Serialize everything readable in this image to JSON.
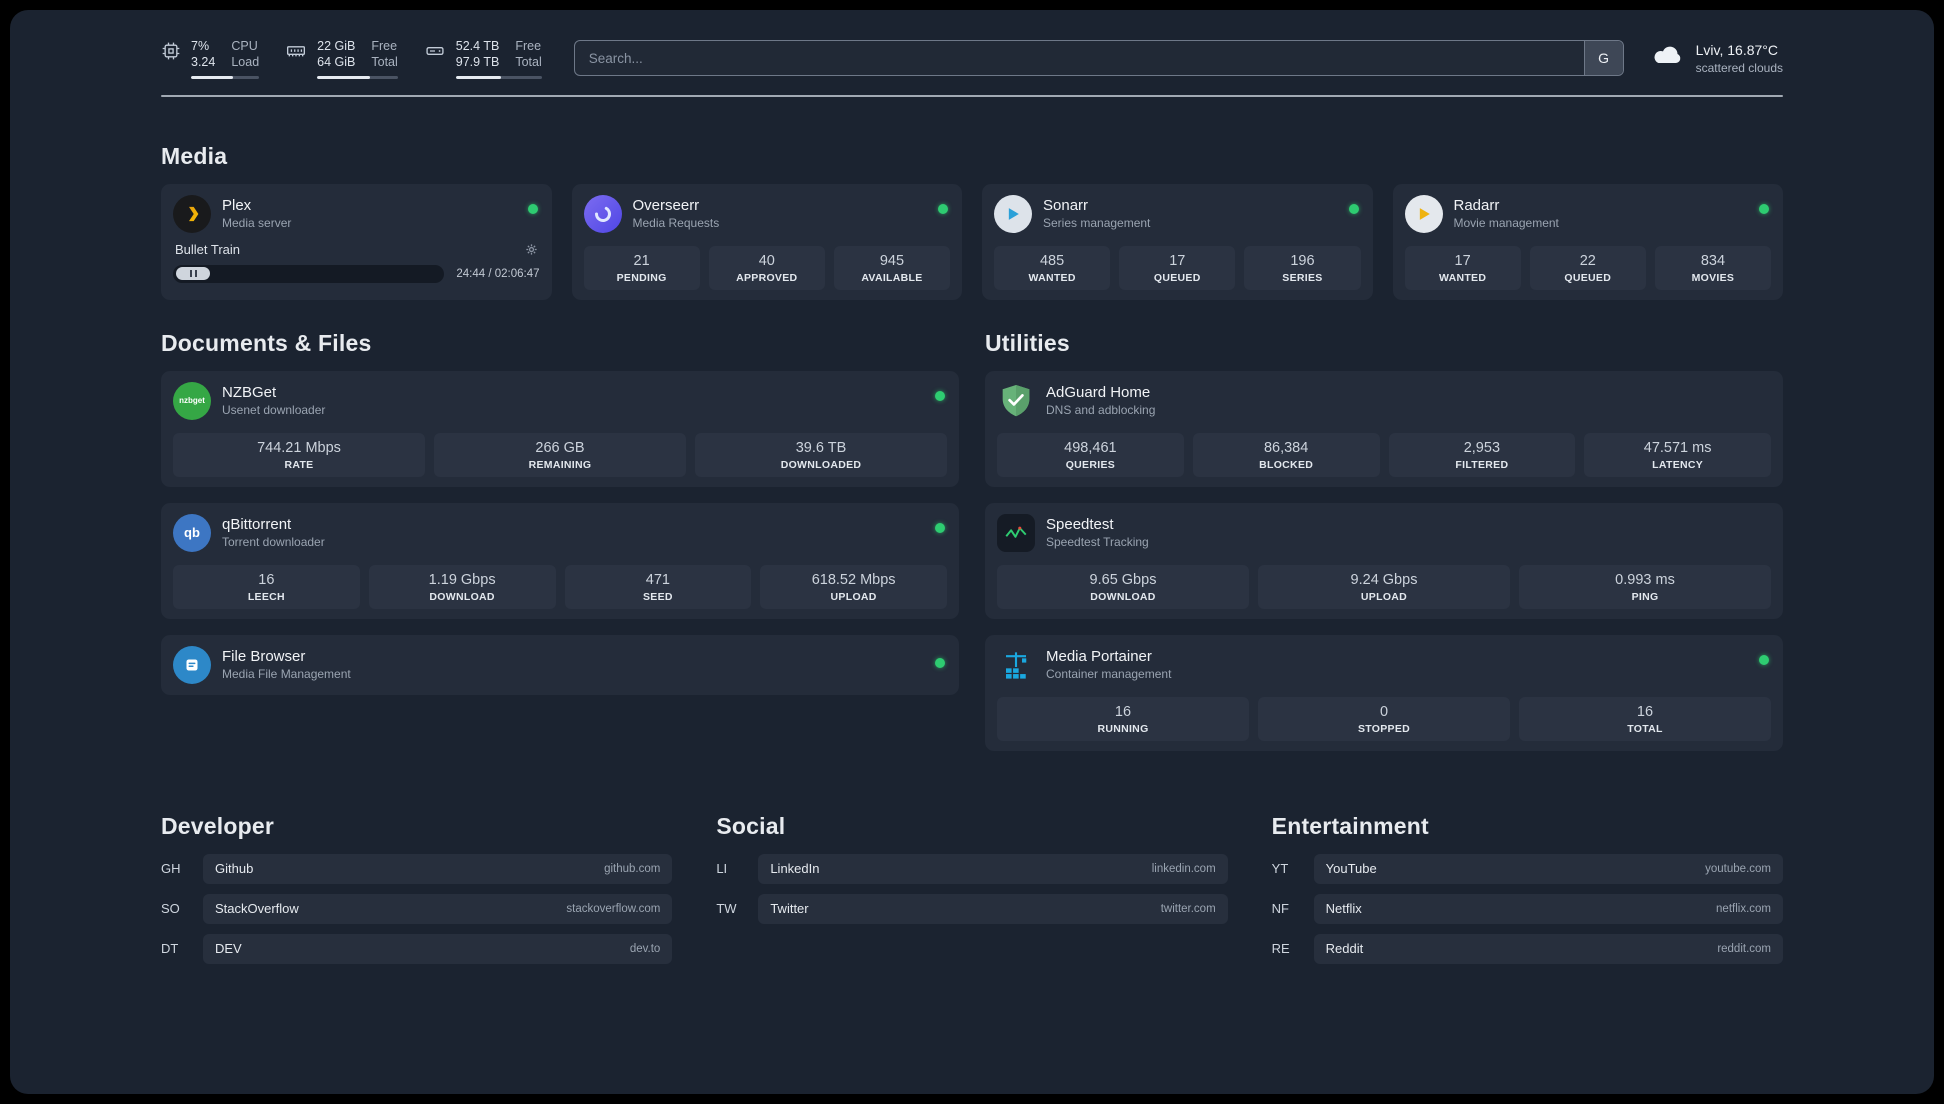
{
  "colors": {
    "status_online": "#2ecc71",
    "background": "#1b2330",
    "card": "#242c3a",
    "accent_blue": "#2aa0d8",
    "accent_yellow": "#efb310",
    "accent_green": "#35a745"
  },
  "topbar": {
    "cpu": {
      "icon": "cpu-icon",
      "value_top": "7%",
      "value_bottom": "3.24",
      "label_top": "CPU",
      "label_bottom": "Load"
    },
    "memory": {
      "icon": "memory-icon",
      "value_top": "22 GiB",
      "value_bottom": "64 GiB",
      "label_top": "Free",
      "label_bottom": "Total"
    },
    "disk": {
      "icon": "disk-icon",
      "value_top": "52.4 TB",
      "value_bottom": "97.9 TB",
      "label_top": "Free",
      "label_bottom": "Total"
    },
    "search": {
      "placeholder": "Search...",
      "button": "G"
    },
    "weather": {
      "icon": "cloud-icon",
      "location": "Lviv, 16.87°C",
      "condition": "scattered clouds"
    }
  },
  "sections": {
    "media": "Media",
    "documents": "Documents & Files",
    "utilities": "Utilities",
    "developer": "Developer",
    "social": "Social",
    "entertainment": "Entertainment"
  },
  "services": {
    "plex": {
      "name": "Plex",
      "subtitle": "Media server",
      "icon": "plex-icon",
      "now_playing": {
        "title": "Bullet Train",
        "time": "24:44 / 02:06:47"
      }
    },
    "overseerr": {
      "name": "Overseerr",
      "subtitle": "Media Requests",
      "icon": "overseerr-icon",
      "stats": [
        {
          "value": "21",
          "label": "PENDING"
        },
        {
          "value": "40",
          "label": "APPROVED"
        },
        {
          "value": "945",
          "label": "AVAILABLE"
        }
      ]
    },
    "sonarr": {
      "name": "Sonarr",
      "subtitle": "Series management",
      "icon": "sonarr-icon",
      "stats": [
        {
          "value": "485",
          "label": "WANTED"
        },
        {
          "value": "17",
          "label": "QUEUED"
        },
        {
          "value": "196",
          "label": "SERIES"
        }
      ]
    },
    "radarr": {
      "name": "Radarr",
      "subtitle": "Movie management",
      "icon": "radarr-icon",
      "stats": [
        {
          "value": "17",
          "label": "WANTED"
        },
        {
          "value": "22",
          "label": "QUEUED"
        },
        {
          "value": "834",
          "label": "MOVIES"
        }
      ]
    },
    "nzbget": {
      "name": "NZBGet",
      "subtitle": "Usenet downloader",
      "icon": "nzbget-icon",
      "icon_text": "nzbget",
      "stats": [
        {
          "value": "744.21 Mbps",
          "label": "RATE"
        },
        {
          "value": "266 GB",
          "label": "REMAINING"
        },
        {
          "value": "39.6 TB",
          "label": "DOWNLOADED"
        }
      ]
    },
    "qbittorrent": {
      "name": "qBittorrent",
      "subtitle": "Torrent downloader",
      "icon": "qbittorrent-icon",
      "icon_text": "qb",
      "stats": [
        {
          "value": "16",
          "label": "LEECH"
        },
        {
          "value": "1.19 Gbps",
          "label": "DOWNLOAD"
        },
        {
          "value": "471",
          "label": "SEED"
        },
        {
          "value": "618.52 Mbps",
          "label": "UPLOAD"
        }
      ]
    },
    "filebrowser": {
      "name": "File Browser",
      "subtitle": "Media File Management",
      "icon": "filebrowser-icon"
    },
    "adguard": {
      "name": "AdGuard Home",
      "subtitle": "DNS and adblocking",
      "icon": "adguard-icon",
      "stats": [
        {
          "value": "498,461",
          "label": "QUERIES"
        },
        {
          "value": "86,384",
          "label": "BLOCKED"
        },
        {
          "value": "2,953",
          "label": "FILTERED"
        },
        {
          "value": "47.571 ms",
          "label": "LATENCY"
        }
      ]
    },
    "speedtest": {
      "name": "Speedtest",
      "subtitle": "Speedtest Tracking",
      "icon": "speedtest-icon",
      "stats": [
        {
          "value": "9.65 Gbps",
          "label": "DOWNLOAD"
        },
        {
          "value": "9.24 Gbps",
          "label": "UPLOAD"
        },
        {
          "value": "0.993 ms",
          "label": "PING"
        }
      ]
    },
    "portainer": {
      "name": "Media Portainer",
      "subtitle": "Container management",
      "icon": "portainer-icon",
      "stats": [
        {
          "value": "16",
          "label": "RUNNING"
        },
        {
          "value": "0",
          "label": "STOPPED"
        },
        {
          "value": "16",
          "label": "TOTAL"
        }
      ]
    }
  },
  "bookmarks": {
    "developer": [
      {
        "abbr": "GH",
        "name": "Github",
        "url": "github.com"
      },
      {
        "abbr": "SO",
        "name": "StackOverflow",
        "url": "stackoverflow.com"
      },
      {
        "abbr": "DT",
        "name": "DEV",
        "url": "dev.to"
      }
    ],
    "social": [
      {
        "abbr": "LI",
        "name": "LinkedIn",
        "url": "linkedin.com"
      },
      {
        "abbr": "TW",
        "name": "Twitter",
        "url": "twitter.com"
      }
    ],
    "entertainment": [
      {
        "abbr": "YT",
        "name": "YouTube",
        "url": "youtube.com"
      },
      {
        "abbr": "NF",
        "name": "Netflix",
        "url": "netflix.com"
      },
      {
        "abbr": "RE",
        "name": "Reddit",
        "url": "reddit.com"
      }
    ]
  }
}
